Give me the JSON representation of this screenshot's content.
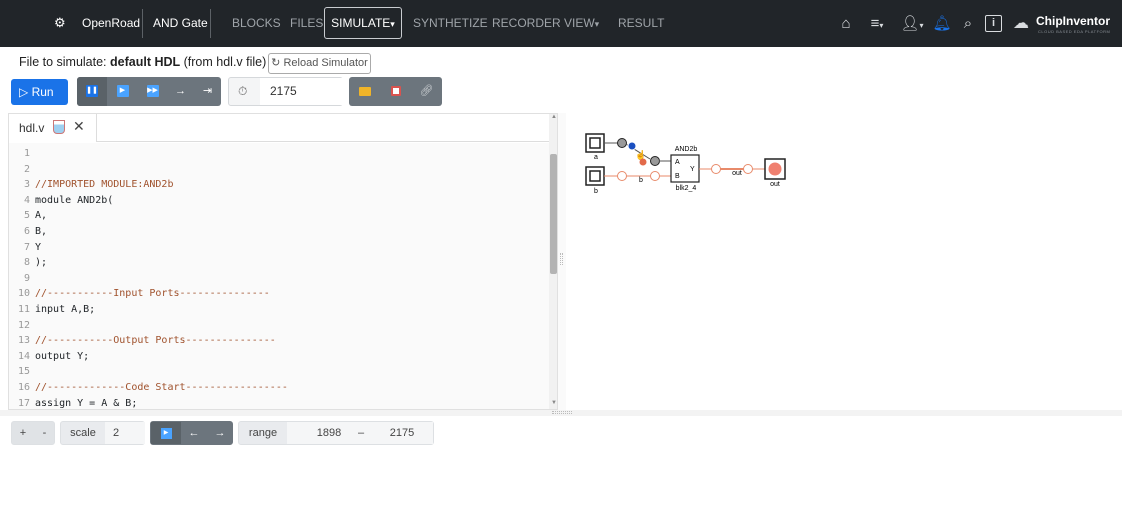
{
  "nav": {
    "brand": "OpenRoad",
    "project": "AND Gate",
    "items": [
      "BLOCKS",
      "FILES",
      "SIMULATE",
      "SYNTHETIZE",
      "RECORDER",
      "VIEW",
      "RESULT"
    ],
    "simulate_caret": "▾",
    "view_caret": "▾",
    "logo": "ChipInventor",
    "logo_sub": "CLOUD BASED EDA PLATFORM"
  },
  "file_info": {
    "prefix": "File to simulate: ",
    "name": "default HDL",
    "suffix": " (from hdl.v file)",
    "reload": "Reload Simulator"
  },
  "toolbar": {
    "run": "Run",
    "time": "2175"
  },
  "editor": {
    "tab": "hdl.v",
    "lines": [
      {
        "n": "1",
        "t": ""
      },
      {
        "n": "2",
        "t": ""
      },
      {
        "n": "3",
        "t": "//IMPORTED MODULE:AND2b",
        "c": true
      },
      {
        "n": "4",
        "t": "module AND2b("
      },
      {
        "n": "5",
        "t": "A,"
      },
      {
        "n": "6",
        "t": "B,"
      },
      {
        "n": "7",
        "t": "Y"
      },
      {
        "n": "8",
        "t": ");"
      },
      {
        "n": "9",
        "t": ""
      },
      {
        "n": "10",
        "t": "//-----------Input Ports---------------",
        "c": true
      },
      {
        "n": "11",
        "t": "input A,B;"
      },
      {
        "n": "12",
        "t": ""
      },
      {
        "n": "13",
        "t": "//-----------Output Ports---------------",
        "c": true
      },
      {
        "n": "14",
        "t": "output Y;"
      },
      {
        "n": "15",
        "t": ""
      },
      {
        "n": "16",
        "t": "//-------------Code Start-----------------",
        "c": true
      },
      {
        "n": "17",
        "t": "assign Y = A & B;"
      }
    ]
  },
  "circuit": {
    "in_a": "a",
    "in_b": "b",
    "gate_title": "AND2b",
    "gate_a": "A",
    "gate_b": "B",
    "gate_y": "Y",
    "gate_name": "blk2_4",
    "wire_b": "b",
    "wire_out": "out",
    "out_label": "out"
  },
  "wave": {
    "plus": "+",
    "minus": "-",
    "scale_label": "scale",
    "scale": "2",
    "left": "←",
    "right": "→",
    "range_label": "range",
    "range_start": "1898",
    "range_dash": "–",
    "range_end": "2175"
  },
  "colors": {
    "nav_bg": "#212529",
    "run": "#1a73e8",
    "wire": "#e88a6a",
    "signal": "#f08070"
  }
}
